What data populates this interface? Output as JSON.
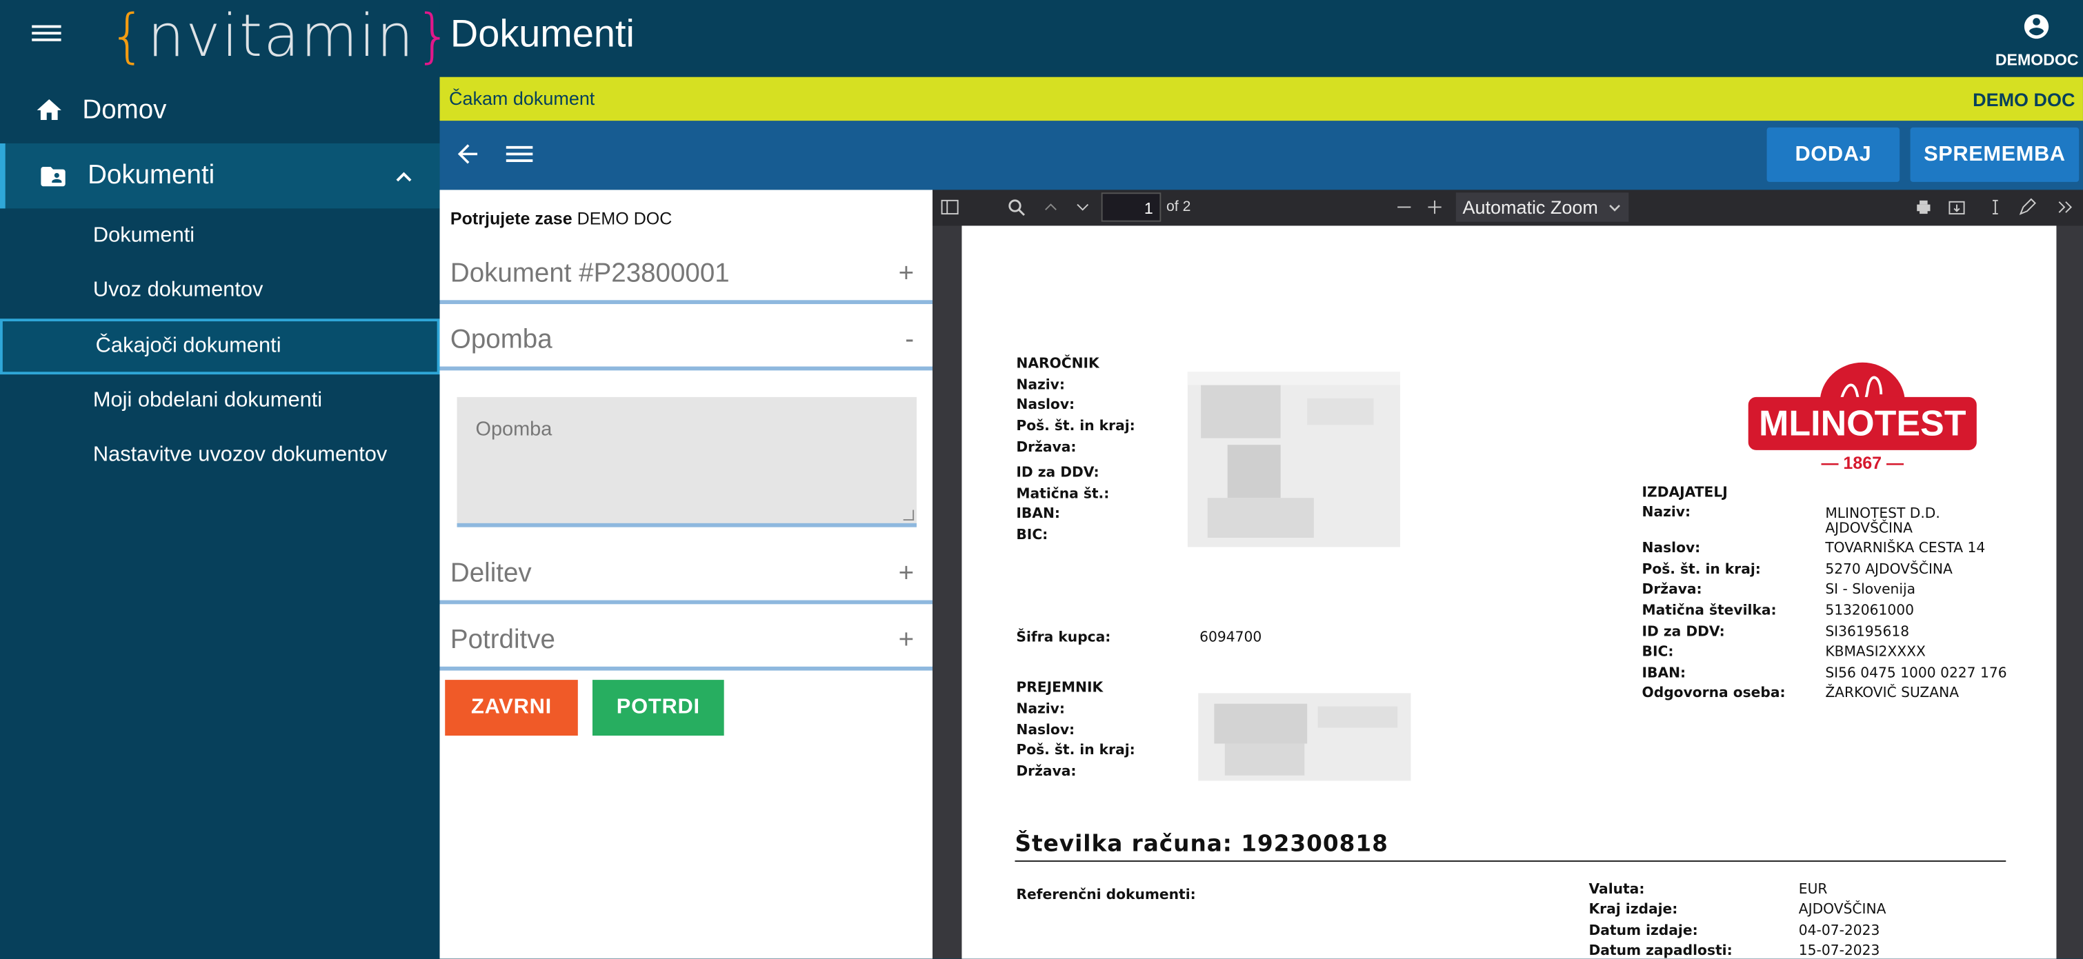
{
  "sidebar": {
    "logo": {
      "left": "{",
      "text": "nvitamin",
      "right": "}"
    },
    "home_label": "Domov",
    "docs_label": "Dokumenti",
    "sub_items": [
      "Dokumenti",
      "Uvoz dokumentov",
      "Čakajoči dokumenti",
      "Moji obdelani dokumenti",
      "Nastavitve uvozov dokumentov"
    ],
    "active_sub": "Čakajoči dokumenti"
  },
  "header": {
    "title": "Dokumenti",
    "user": "DEMODOC"
  },
  "status": {
    "left": "Čakam dokument",
    "right": "DEMO DOC"
  },
  "toolbar": {
    "add_label": "DODAJ",
    "change_label": "SPREMEMBA"
  },
  "panel": {
    "confirm_prefix": "Potrjujete zase",
    "confirm_name": "DEMO DOC",
    "sections": [
      {
        "title": "Dokument #P23800001",
        "sign": "+"
      },
      {
        "title": "Opomba",
        "sign": "-"
      },
      {
        "title": "Delitev",
        "sign": "+"
      },
      {
        "title": "Potrditve",
        "sign": "+"
      }
    ],
    "note_placeholder": "Opomba",
    "close_label": "ZAVRNI",
    "confirm_label": "POTRDI"
  },
  "colors": {
    "sidebar": "#07405b",
    "status": "#d6e022",
    "toolbar": "#175c92",
    "button": "#1e79c4",
    "reject": "#f05a28",
    "confirm": "#27ae60"
  },
  "pdf": {
    "page": "1",
    "of_pages": "of 2",
    "zoom": "Automatic Zoom",
    "buyer": {
      "heading": "NAROČNIK",
      "labels": [
        "Naziv:",
        "Naslov:",
        "Poš. št. in kraj:",
        "Država:",
        "ID za DDV:",
        "Matična št.:",
        "IBAN:",
        "BIC:"
      ]
    },
    "customer_code": {
      "label": "Šifra kupca:",
      "value": "6094700"
    },
    "receiver": {
      "heading": "PREJEMNIK",
      "labels": [
        "Naziv:",
        "Naslov:",
        "Poš. št. in kraj:",
        "Država:"
      ]
    },
    "brand": {
      "name": "MLINOTEST",
      "year": "— 1867 —"
    },
    "issuer": {
      "heading": "IZDAJATELJ",
      "rows": [
        {
          "label": "Naziv:",
          "value": "MLINOTEST D.D.",
          "value2": "AJDOVŠČINA"
        },
        {
          "label": "Naslov:",
          "value": "TOVARNIŠKA CESTA 14"
        },
        {
          "label": "Poš. št. in kraj:",
          "value": "5270 AJDOVŠČINA"
        },
        {
          "label": "Država:",
          "value": "SI - Slovenija"
        },
        {
          "label": "Matična številka:",
          "value": "5132061000"
        },
        {
          "label": "ID za DDV:",
          "value": "SI36195618"
        },
        {
          "label": "BIC:",
          "value": "KBMASI2XXXX"
        },
        {
          "label": "IBAN:",
          "value": "SI56 0475 1000 0227 176"
        },
        {
          "label": "Odgovorna oseba:",
          "value": "ŽARKOVIČ SUZANA"
        }
      ]
    },
    "invoice_title": "Številka računa:  192300818",
    "ref_label": "Referenčni dokumenti:",
    "meta": [
      {
        "label": "Valuta:",
        "value": "EUR"
      },
      {
        "label": "Kraj izdaje:",
        "value": "AJDOVŠČINA"
      },
      {
        "label": "Datum izdaje:",
        "value": "04-07-2023"
      },
      {
        "label": "Datum zapadlosti:",
        "value": "15-07-2023"
      }
    ]
  }
}
